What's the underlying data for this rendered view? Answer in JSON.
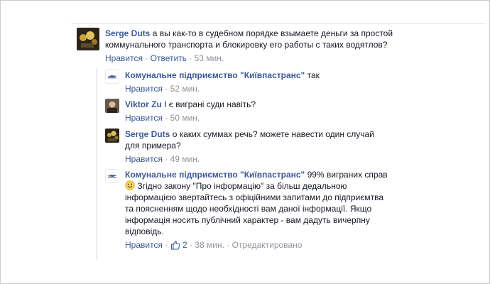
{
  "comments": [
    {
      "author": "Serge Duts",
      "text_l1": "а вы как-то в судебном порядке взымаете деньги за простой",
      "text_l2": "коммунального транспорта и блокировку его работы с таких водятлов?",
      "like": "Нравится",
      "reply": "Ответить",
      "time": "53 мин."
    },
    {
      "author": "Комунальне підприємство \"Київпастранс\"",
      "text": "так",
      "like": "Нравится",
      "time": "52 мин."
    },
    {
      "author": "Viktor Zu",
      "text": "І є виграні суди навіть?",
      "like": "Нравится",
      "time": "50 мин."
    },
    {
      "author": "Serge Duts",
      "text_l1": "о каких суммах речь? можете навести один случай",
      "text_l2": "для примера?",
      "like": "Нравится",
      "time": "49 мин."
    },
    {
      "author": "Комунальне підприємство \"Київпастранс\"",
      "text_l1": "99% виграних справ",
      "text_l2": "Згідно закону \"Про інформацію\" за більш дедальною",
      "text_l3": "інформацією звертайтесь з офіційними запитами до підприємтва",
      "text_l4": "та поясненням щодо необхідності вам даної інформації. Якщо",
      "text_l5": "інформація носить публічний характер - вам дадуть вичерпну",
      "text_l6": "відповідь.",
      "like": "Нравится",
      "likes_count": "2",
      "time": "38 мин.",
      "edited": "Отредактировано"
    }
  ],
  "separator": "·",
  "colors": {
    "link": "#3b5998",
    "meta": "#90949c",
    "text": "#141823"
  }
}
